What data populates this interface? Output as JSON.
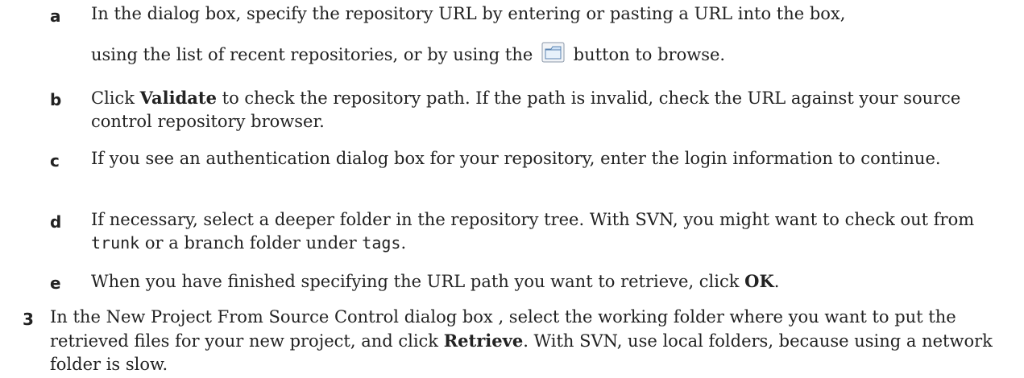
{
  "steps": {
    "a": {
      "marker": "a",
      "line1": "In the dialog box, specify the repository URL by entering or pasting a URL into the box,",
      "line2_pre": "using the list of recent repositories, or by using the",
      "line2_post": "button to browse."
    },
    "b": {
      "marker": "b",
      "pre": "Click ",
      "bold": "Validate",
      "post": " to check the repository path. If the path is invalid, check the URL against your source control repository browser."
    },
    "c": {
      "marker": "c",
      "text": "If you see an authentication dialog box for your repository, enter the login information to continue."
    },
    "d": {
      "marker": "d",
      "pre": "If necessary, select a deeper folder in the repository tree. With SVN, you might want to check out from ",
      "code1": "trunk",
      "mid": " or a branch folder under ",
      "code2": "tags",
      "post": "."
    },
    "e": {
      "marker": "e",
      "pre": "When you have finished specifying the URL path you want to retrieve, click ",
      "bold": "OK",
      "post": "."
    },
    "three": {
      "marker": "3",
      "pre": "In the New Project From Source Control dialog box , select the working folder where you want to put the retrieved files for your new project, and click ",
      "bold": "Retrieve",
      "post": ". With SVN, use local folders, because using a network folder is slow."
    }
  },
  "icons": {
    "browse": "folder-browse-icon"
  }
}
